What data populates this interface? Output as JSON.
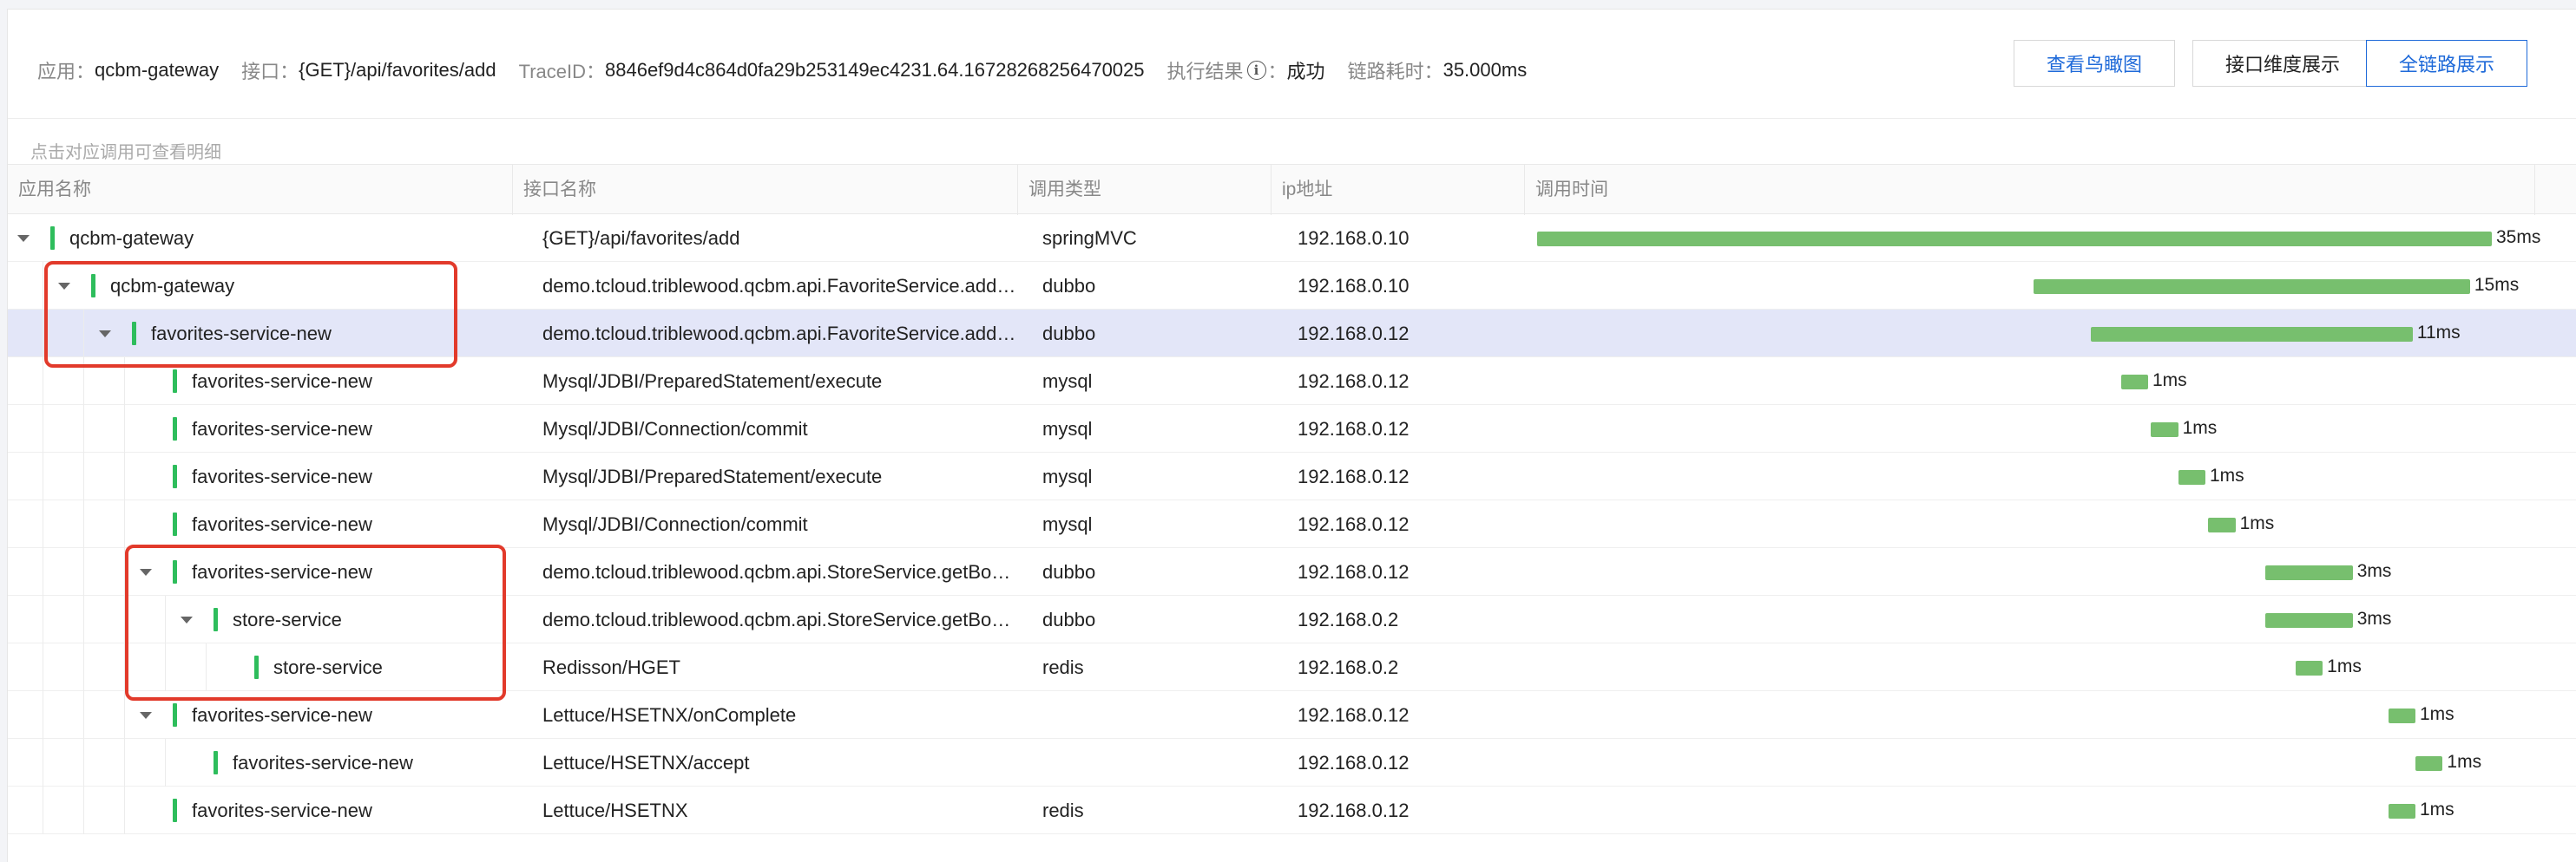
{
  "header": {
    "app_key": "应用：",
    "app_val": "qcbm-gateway",
    "api_key": "接口：",
    "api_val": "{GET}/api/favorites/add",
    "trace_key": "TraceID：",
    "trace_val": "8846ef9d4c864d0fa29b253149ec4231.64.16728268256470025",
    "result_key": "执行结果",
    "result_sep": "：",
    "result_val": "成功",
    "cost_key": "链路耗时：",
    "cost_val": "35.000ms",
    "info_icon_glyph": "i",
    "btn_birdview": "查看鸟瞰图",
    "btn_interface": "接口维度展示",
    "btn_fulllink": "全链路展示"
  },
  "hint": "点击对应调用可查看明细",
  "columns": {
    "app": "应用名称",
    "api": "接口名称",
    "type": "调用类型",
    "ip": "ip地址",
    "time": "调用时间"
  },
  "timeline_total_ms": 35,
  "rows": [
    {
      "depth": 0,
      "expanded": true,
      "app": "qcbm-gateway",
      "api": "{GET}/api/favorites/add",
      "type": "springMVC",
      "ip": "192.168.0.10",
      "start_ms": 0,
      "dur_ms": 35,
      "label": "35ms",
      "selected": false
    },
    {
      "depth": 1,
      "expanded": true,
      "app": "qcbm-gateway",
      "api": "demo.tcloud.triblewood.qcbm.api.FavoriteService.addFavorite",
      "type": "dubbo",
      "ip": "192.168.0.10",
      "start_ms": 18.2,
      "dur_ms": 16,
      "label": "15ms",
      "selected": false
    },
    {
      "depth": 2,
      "expanded": true,
      "app": "favorites-service-new",
      "api": "demo.tcloud.triblewood.qcbm.api.FavoriteService.addFavorite",
      "type": "dubbo",
      "ip": "192.168.0.12",
      "start_ms": 20.3,
      "dur_ms": 11.8,
      "label": "11ms",
      "selected": true
    },
    {
      "depth": 3,
      "expanded": null,
      "app": "favorites-service-new",
      "api": "Mysql/JDBI/PreparedStatement/execute",
      "type": "mysql",
      "ip": "192.168.0.12",
      "start_ms": 21.4,
      "dur_ms": 1,
      "label": "1ms",
      "selected": false
    },
    {
      "depth": 3,
      "expanded": null,
      "app": "favorites-service-new",
      "api": "Mysql/JDBI/Connection/commit",
      "type": "mysql",
      "ip": "192.168.0.12",
      "start_ms": 22.5,
      "dur_ms": 1,
      "label": "1ms",
      "selected": false
    },
    {
      "depth": 3,
      "expanded": null,
      "app": "favorites-service-new",
      "api": "Mysql/JDBI/PreparedStatement/execute",
      "type": "mysql",
      "ip": "192.168.0.12",
      "start_ms": 23.5,
      "dur_ms": 1,
      "label": "1ms",
      "selected": false
    },
    {
      "depth": 3,
      "expanded": null,
      "app": "favorites-service-new",
      "api": "Mysql/JDBI/Connection/commit",
      "type": "mysql",
      "ip": "192.168.0.12",
      "start_ms": 24.6,
      "dur_ms": 1,
      "label": "1ms",
      "selected": false
    },
    {
      "depth": 3,
      "expanded": true,
      "app": "favorites-service-new",
      "api": "demo.tcloud.triblewood.qcbm.api.StoreService.getBookById",
      "type": "dubbo",
      "ip": "192.168.0.12",
      "start_ms": 26.7,
      "dur_ms": 3.2,
      "label": "3ms",
      "selected": false
    },
    {
      "depth": 4,
      "expanded": true,
      "app": "store-service",
      "api": "demo.tcloud.triblewood.qcbm.api.StoreService.getBookById",
      "type": "dubbo",
      "ip": "192.168.0.2",
      "start_ms": 26.7,
      "dur_ms": 3.2,
      "label": "3ms",
      "selected": false
    },
    {
      "depth": 5,
      "expanded": null,
      "app": "store-service",
      "api": "Redisson/HGET",
      "type": "redis",
      "ip": "192.168.0.2",
      "start_ms": 27.8,
      "dur_ms": 1,
      "label": "1ms",
      "selected": false
    },
    {
      "depth": 3,
      "expanded": true,
      "app": "favorites-service-new",
      "api": "Lettuce/HSETNX/onComplete",
      "type": "",
      "ip": "192.168.0.12",
      "start_ms": 31.2,
      "dur_ms": 1,
      "label": "1ms",
      "selected": false
    },
    {
      "depth": 4,
      "expanded": null,
      "app": "favorites-service-new",
      "api": "Lettuce/HSETNX/accept",
      "type": "",
      "ip": "192.168.0.12",
      "start_ms": 32.2,
      "dur_ms": 1,
      "label": "1ms",
      "selected": false
    },
    {
      "depth": 3,
      "expanded": null,
      "app": "favorites-service-new",
      "api": "Lettuce/HSETNX",
      "type": "redis",
      "ip": "192.168.0.12",
      "start_ms": 31.2,
      "dur_ms": 1,
      "label": "1ms",
      "selected": false
    }
  ]
}
